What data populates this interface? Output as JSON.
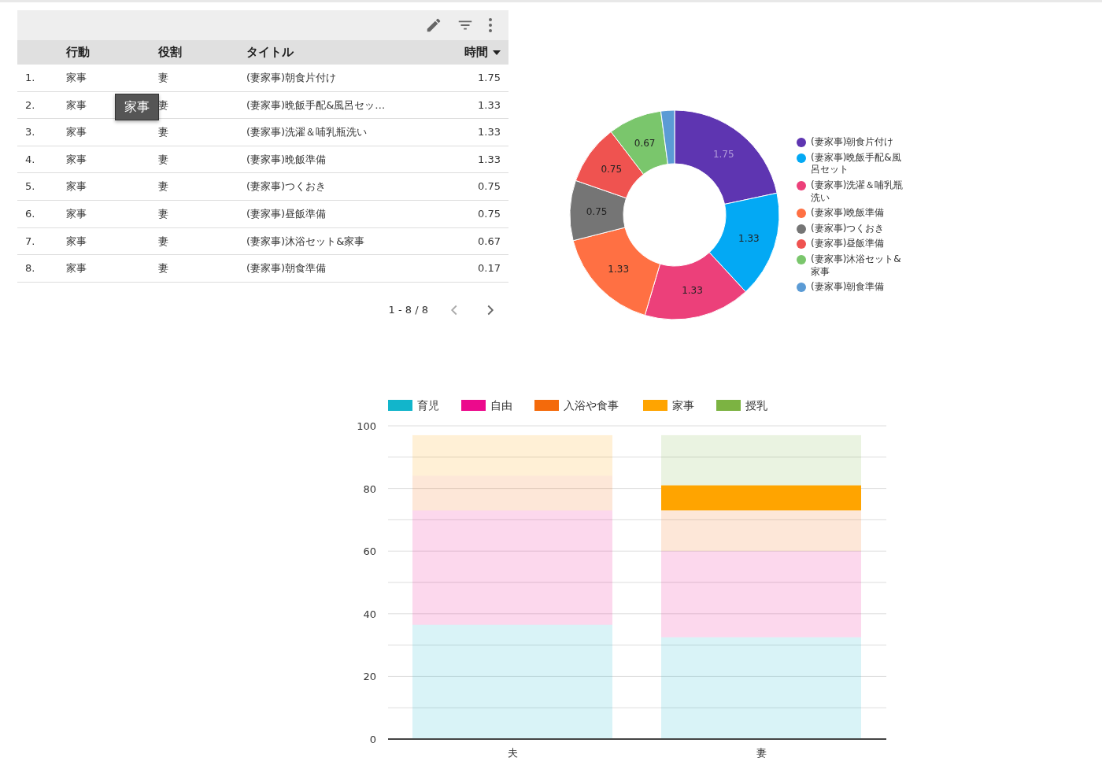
{
  "table": {
    "toolbar": {
      "edit": true,
      "filter": true,
      "more": true
    },
    "columns": [
      {
        "label": "行動",
        "sorted": false
      },
      {
        "label": "役割",
        "sorted": false
      },
      {
        "label": "タイトル",
        "sorted": false
      },
      {
        "label": "時間",
        "sorted": true
      }
    ],
    "rows": [
      {
        "index": "1.",
        "cells": [
          "家事",
          "妻",
          "(妻家事)朝食片付け",
          "1.75"
        ]
      },
      {
        "index": "2.",
        "cells": [
          "家事",
          "妻",
          "(妻家事)晩飯手配&風呂セッ…",
          "1.33"
        ],
        "tooltip": "家事"
      },
      {
        "index": "3.",
        "cells": [
          "家事",
          "妻",
          "(妻家事)洗濯＆哺乳瓶洗い",
          "1.33"
        ]
      },
      {
        "index": "4.",
        "cells": [
          "家事",
          "妻",
          "(妻家事)晩飯準備",
          "1.33"
        ]
      },
      {
        "index": "5.",
        "cells": [
          "家事",
          "妻",
          "(妻家事)つくおき",
          "0.75"
        ]
      },
      {
        "index": "6.",
        "cells": [
          "家事",
          "妻",
          "(妻家事)昼飯準備",
          "0.75"
        ]
      },
      {
        "index": "7.",
        "cells": [
          "家事",
          "妻",
          "(妻家事)沐浴セット&家事",
          "0.67"
        ]
      },
      {
        "index": "8.",
        "cells": [
          "家事",
          "妻",
          "(妻家事)朝食準備",
          "0.17"
        ]
      }
    ],
    "pagination": {
      "range": "1 - 8 / 8",
      "prev_disabled": true,
      "next_disabled": false
    }
  },
  "donut": {
    "chart_data": {
      "type": "donut",
      "categories": [
        "(妻家事)朝食片付け",
        "(妻家事)晩飯手配&風呂セット",
        "(妻家事)洗濯＆哺乳瓶洗い",
        "(妻家事)晩飯準備",
        "(妻家事)つくおき",
        "(妻家事)昼飯準備",
        "(妻家事)沐浴セット&家事",
        "(妻家事)朝食準備"
      ],
      "values": [
        1.75,
        1.33,
        1.33,
        1.33,
        0.75,
        0.75,
        0.67,
        0.17
      ],
      "colors": [
        "#5e35b1",
        "#03a9f4",
        "#ec407a",
        "#ff7043",
        "#757575",
        "#ef5350",
        "#7ac66c",
        "#5b9bd5"
      ],
      "value_labels": [
        "1.75",
        "1.33",
        "1.33",
        "1.33",
        "0.75",
        "0.75",
        "0.67",
        null
      ]
    }
  },
  "bar_chart": {
    "chart_data": {
      "type": "bar",
      "stacked": true,
      "orientation": "vertical",
      "categories": [
        "夫",
        "妻"
      ],
      "series": [
        {
          "name": "育児",
          "color": "#12b5cb",
          "values": [
            36.5,
            32.5
          ]
        },
        {
          "name": "自由",
          "color": "#ec0a8c",
          "values": [
            36.5,
            27.5
          ]
        },
        {
          "name": "入浴や食事",
          "color": "#f46a0b",
          "values": [
            11,
            13
          ]
        },
        {
          "name": "家事",
          "color": "#ffa400",
          "values": [
            13,
            8
          ]
        },
        {
          "name": "授乳",
          "color": "#7cb342",
          "values": [
            0,
            16
          ]
        }
      ],
      "ylim": [
        0,
        100
      ],
      "yticks": [
        0,
        20,
        40,
        60,
        80,
        100
      ],
      "grid": true,
      "legend": true
    },
    "highlight": [
      [
        false,
        false
      ],
      [
        false,
        false
      ],
      [
        false,
        false
      ],
      [
        false,
        true
      ],
      [
        false,
        false
      ]
    ]
  }
}
